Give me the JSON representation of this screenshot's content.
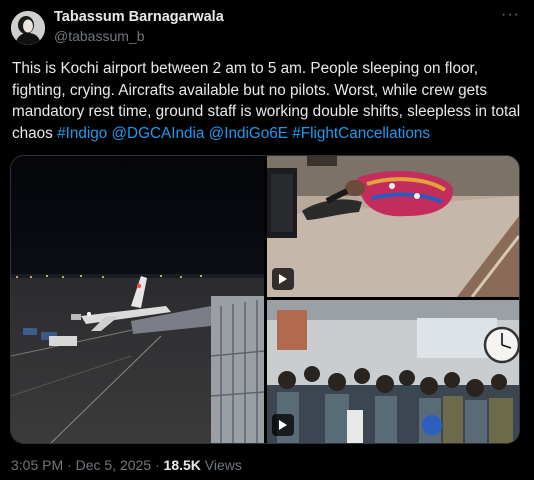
{
  "author": {
    "name": "Tabassum Barnagarwala",
    "handle": "@tabassum_b"
  },
  "tweet": {
    "text": "This is Kochi airport between 2 am to 5 am. People sleeping on floor, fighting, crying. Aircrafts available but no pilots. Worst, while crew gets mandatory rest time, ground staff is working double shifts, sleepless in total chaos",
    "hashtags": [
      "#Indigo",
      "@DGCAIndia",
      "@IndiGo6E",
      "#FlightCancellations"
    ]
  },
  "media": {
    "items": [
      {
        "type": "photo",
        "subject": "airport apron at night"
      },
      {
        "type": "video",
        "subject": "people sleeping on floor"
      },
      {
        "type": "video",
        "subject": "crowd at terminal"
      }
    ]
  },
  "meta": {
    "time": "3:05 PM",
    "separator": "·",
    "date": "Dec 5, 2025",
    "views_count": "18.5K",
    "views_label": "Views"
  },
  "icons": {
    "more": "more-icon",
    "play": "play-icon"
  },
  "colors": {
    "background": "#000000",
    "text": "#e7e9ea",
    "secondary": "#71767b",
    "link": "#1d9bf0"
  }
}
